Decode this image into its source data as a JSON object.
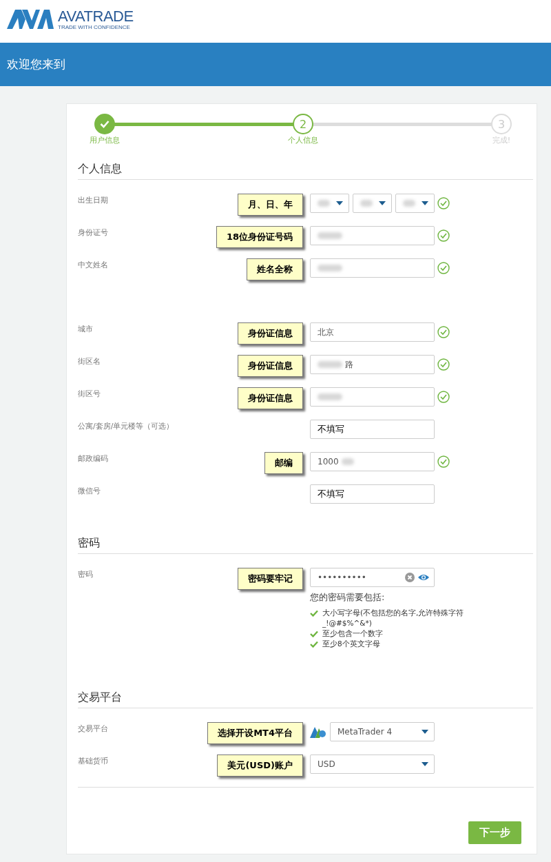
{
  "logo": {
    "name": "AVATRADE",
    "tagline": "TRADE WITH CONFIDENCE"
  },
  "banner": {
    "title": "欢迎您来到"
  },
  "steps": [
    {
      "label": "用户信息",
      "kind": "done"
    },
    {
      "number": "2",
      "label": "个人信息",
      "kind": "current"
    },
    {
      "number": "3",
      "label": "完成!",
      "kind": "pending"
    }
  ],
  "sections": [
    {
      "title": "个人信息",
      "rows": [
        {
          "label": "出生日期",
          "note": "月、日、年",
          "control": {
            "kind": "selects",
            "selects": [
              {
                "blurred": true
              },
              {
                "blurred": true
              },
              {
                "blurred": true
              }
            ]
          },
          "valid": true
        },
        {
          "label": "身份证号",
          "note": "18位身份证号码",
          "control": {
            "kind": "text",
            "blur_before": true
          },
          "valid": true
        },
        {
          "label": "中文姓名",
          "note": "姓名全称",
          "control": {
            "kind": "text",
            "blur_before": true
          },
          "valid": true
        },
        {
          "label": "城市",
          "note": "身份证信息",
          "spaced": true,
          "control": {
            "kind": "text",
            "value": "北京"
          },
          "valid": true
        },
        {
          "label": "街区名",
          "note": "身份证信息",
          "control": {
            "kind": "text",
            "value": "路",
            "blur_before": true
          },
          "valid": true
        },
        {
          "label": "街区号",
          "note": "身份证信息",
          "control": {
            "kind": "text",
            "blur_before": true
          },
          "valid": true
        },
        {
          "label": "公寓/套房/单元楼等（可选）",
          "control": {
            "kind": "text",
            "value": "不填写",
            "dark": true
          },
          "valid": false
        },
        {
          "label": "邮政编码",
          "note": "邮编",
          "control": {
            "kind": "text",
            "value": "1000",
            "blur_after": true
          },
          "valid": true
        },
        {
          "label": "微信号",
          "control": {
            "kind": "text",
            "value": "不填写",
            "dark": true
          },
          "valid": false
        }
      ]
    },
    {
      "title": "密码",
      "rows": [
        {
          "label": "密码",
          "note": "密码要牢记",
          "control": {
            "kind": "password",
            "value": "••••••••••",
            "heading": "您的密码需要包括:",
            "requirements": [
              {
                "text": "大小写字母(不包括您的名字,允许特殊字符 _!@#$%^&*)",
                "met": true
              },
              {
                "text": "至少包含一个数字",
                "met": true
              },
              {
                "text": "至少8个英文字母",
                "met": true
              }
            ]
          },
          "valid": false
        }
      ]
    },
    {
      "title": "交易平台",
      "rows": [
        {
          "label": "交易平台",
          "note": "选择开设MT4平台",
          "control": {
            "kind": "dropdown",
            "value": "MetaTrader 4",
            "logo": true
          },
          "valid": false
        },
        {
          "label": "基础货币",
          "note": "美元(USD)账户",
          "control": {
            "kind": "dropdown",
            "value": "USD",
            "logo": false
          },
          "valid": false
        }
      ]
    }
  ],
  "next_button": "下一步"
}
